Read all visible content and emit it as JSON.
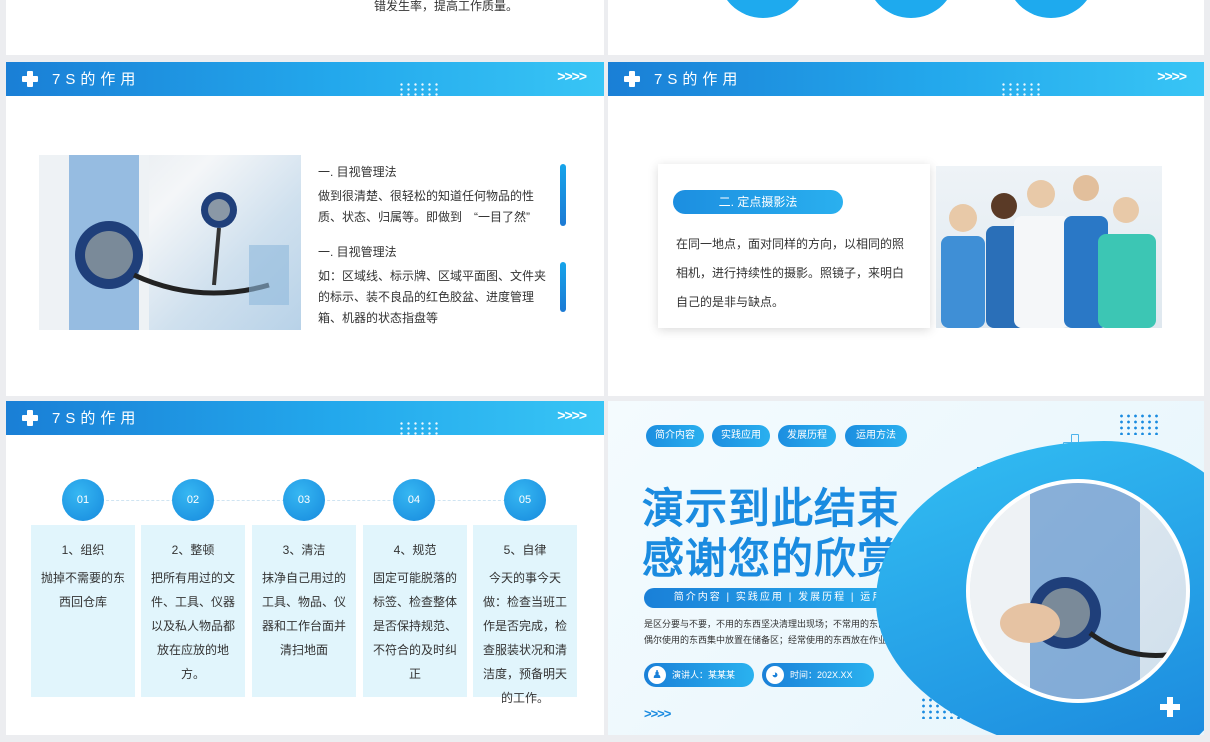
{
  "top_left_fragment": "错发生率，提高工作质量。",
  "header": {
    "title": "7S的作用",
    "arrows": ">>>>"
  },
  "slide1": {
    "items": [
      {
        "heading": "一. 目视管理法",
        "body": "做到很清楚、很轻松的知道任何物品的性质、状态、归属等。即做到　“一目了然”"
      },
      {
        "heading": "一. 目视管理法",
        "body": "如：区域线、标示牌、区域平面图、文件夹的标示、装不良品的红色胶盆、进度管理箱、机器的状态指盘等"
      }
    ]
  },
  "slide2": {
    "pill": "二. 定点摄影法",
    "body": "在同一地点，面对同样的方向，以相同的照相机，进行持续性的摄影。照镜子，来明白自己的是非与缺点。"
  },
  "slide3": {
    "steps": [
      {
        "num": "01",
        "title": "1、组织",
        "body": "抛掉不需要的东西回仓库"
      },
      {
        "num": "02",
        "title": "2、整顿",
        "body": "把所有用过的文件、工具、仪器以及私人物品都放在应放的地方。"
      },
      {
        "num": "03",
        "title": "3、清洁",
        "body": "抹净自己用过的工具、物品、仪器和工作台面并清扫地面"
      },
      {
        "num": "04",
        "title": "4、规范",
        "body": "固定可能脱落的标签、检查整体是否保持规范、不符合的及时纠正"
      },
      {
        "num": "05",
        "title": "5、自律",
        "body": "今天的事今天做：检查当班工作是否完成，检查服装状况和清洁度，预备明天的工作。"
      }
    ]
  },
  "slide4": {
    "tags": [
      "简介内容",
      "实践应用",
      "发展历程",
      "运用方法"
    ],
    "title_line1": "演示到此结束",
    "title_line2": "感谢您的欣赏",
    "subnav": "简介内容 | 实践应用 | 发展历程 | 运用方法",
    "desc": "是区分要与不要，不用的东西坚决清理出现场；不常用的东西放远点；偶尔使用的东西集中放置在储备区；经常使用的东西放在作业区",
    "presenter": "演讲人：某某某",
    "time": "时间：202X.XX",
    "arrows": ">>>>"
  },
  "colors": {
    "primary": "#1a8be0",
    "light": "#36c0f4",
    "card_bg": "#e1f5fc"
  }
}
